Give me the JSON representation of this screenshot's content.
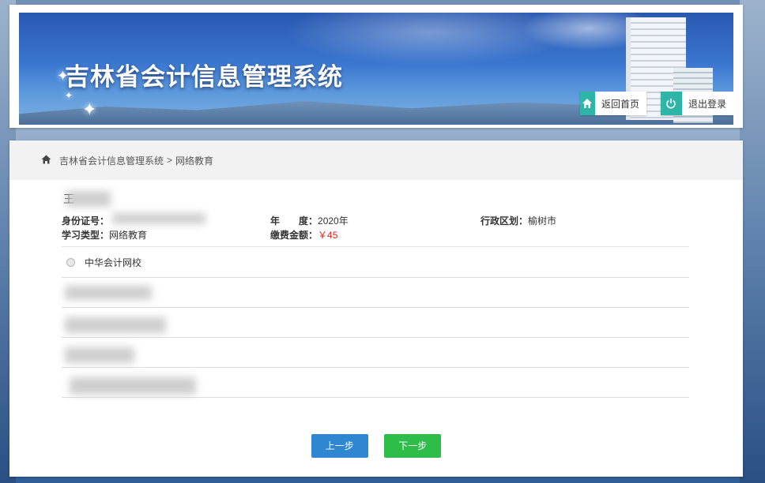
{
  "header": {
    "title": "吉林省会计信息管理系统",
    "home_button": {
      "label": "返回首页",
      "icon": "home-icon"
    },
    "logout_button": {
      "label": "退出登录",
      "icon": "power-icon"
    }
  },
  "breadcrumb": {
    "icon": "home-icon",
    "root": "吉林省会计信息管理系统",
    "separator": ">",
    "current": "网络教育"
  },
  "profile": {
    "name_visible": "王",
    "id_label": "身份证号：",
    "study_type_label": "学习类型：",
    "study_type_value": "网络教育",
    "year_label": "年　　度：",
    "year_value": "2020年",
    "fee_label": "缴费金额：",
    "fee_value": "￥45",
    "region_label": "行政区划：",
    "region_value": "榆树市"
  },
  "school": {
    "label": "中华会计网校"
  },
  "buttons": {
    "prev": "上一步",
    "next": "下一步"
  },
  "colors": {
    "accent_teal": "#2fb5a8",
    "prev_blue": "#2f86d1",
    "next_green": "#2fbd4a",
    "fee_red": "#d9261c"
  }
}
